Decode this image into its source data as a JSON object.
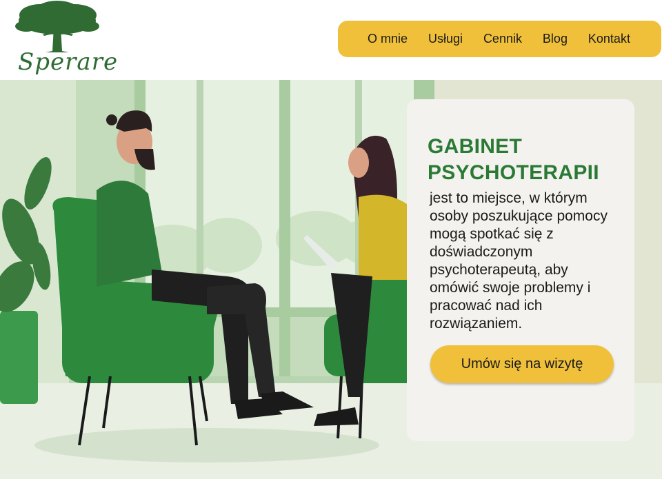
{
  "brand": {
    "name": "Sperare",
    "logo_icon": "tree-icon"
  },
  "nav": {
    "items": [
      {
        "label": "O mnie"
      },
      {
        "label": "Usługi"
      },
      {
        "label": "Cennik"
      },
      {
        "label": "Blog"
      },
      {
        "label": "Kontakt"
      }
    ]
  },
  "hero": {
    "title_line1": "GABINET",
    "title_line2": "PSYCHOTERAPII",
    "description": "jest to miejsce, w którym osoby poszukujące pomocy mogą spotkać się z doświadczonym psychoterapeutą, aby omówić swoje problemy i pracować nad ich rozwiązaniem.",
    "cta_label": "Umów się na wizytę"
  },
  "colors": {
    "accent": "#f0c03a",
    "brand_green": "#2a7a35",
    "card_bg": "#f3f2ee"
  }
}
